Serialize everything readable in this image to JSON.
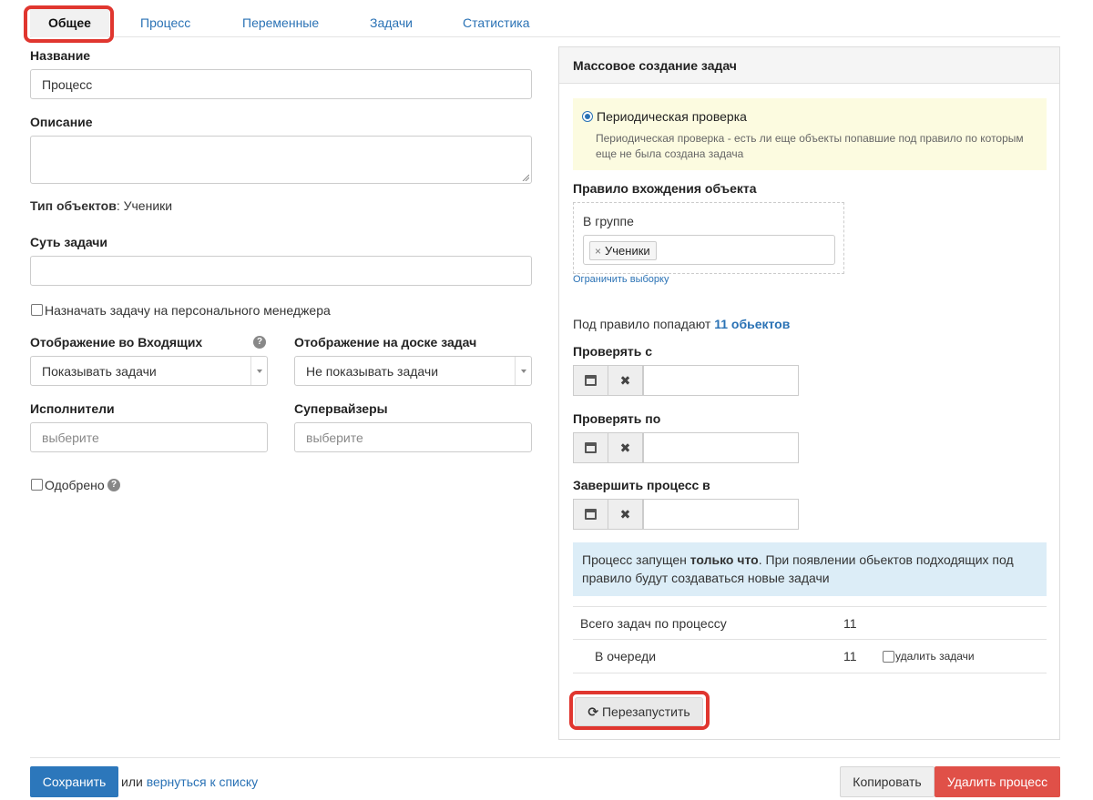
{
  "tabs": [
    {
      "label": "Общее",
      "active": true
    },
    {
      "label": "Процесс"
    },
    {
      "label": "Переменные"
    },
    {
      "label": "Задачи"
    },
    {
      "label": "Статистика"
    }
  ],
  "form": {
    "name_label": "Название",
    "name_value": "Процесс",
    "description_label": "Описание",
    "object_type_label": "Тип объектов",
    "object_type_sep": ":",
    "object_type_value": "Ученики",
    "task_essence_label": "Суть задачи",
    "assign_personal_manager": "Назначать задачу на персонального менеджера",
    "inbox_display_label": "Отображение во Входящих",
    "inbox_display_value": "Показывать задачи",
    "board_display_label": "Отображение на доске задач",
    "board_display_value": "Не показывать задачи",
    "executors_label": "Исполнители",
    "executors_placeholder": "выберите",
    "supervisors_label": "Супервайзеры",
    "supervisors_placeholder": "выберите",
    "approved_label": "Одобрено"
  },
  "panel": {
    "title": "Массовое создание задач",
    "periodic_check_label": "Периодическая проверка",
    "periodic_check_desc_1": "Периодическая проверка - есть ли еще объекты попавшие под правило по которым",
    "periodic_check_desc_2": "еще не была создана задача",
    "rule_label": "Правило вхождения объекта",
    "in_group_label": "В группе",
    "group_tag": "Ученики",
    "limit_link": "Ограничить выборку",
    "matches_prefix": "Под правило попадают ",
    "matches_link": "11 обьектов",
    "check_from_label": "Проверять с",
    "check_to_label": "Проверять по",
    "finish_label": "Завершить процесс в",
    "status_part1": "Процесс запущен ",
    "status_bold": "только что",
    "status_part2": ". При появлении обьектов подходящих под",
    "status_line2": "правило будут создаваться новые задачи",
    "total_tasks_label": "Всего задач по процессу",
    "total_tasks_value": "11",
    "queue_label": "В очереди",
    "queue_value": "11",
    "delete_tasks_label": "удалить задачи",
    "restart_label": "Перезапустить"
  },
  "footer": {
    "save_label": "Сохранить",
    "or_text": "или",
    "back_link": "вернуться к списку",
    "copy_label": "Копировать",
    "delete_label": "Удалить процесс"
  }
}
